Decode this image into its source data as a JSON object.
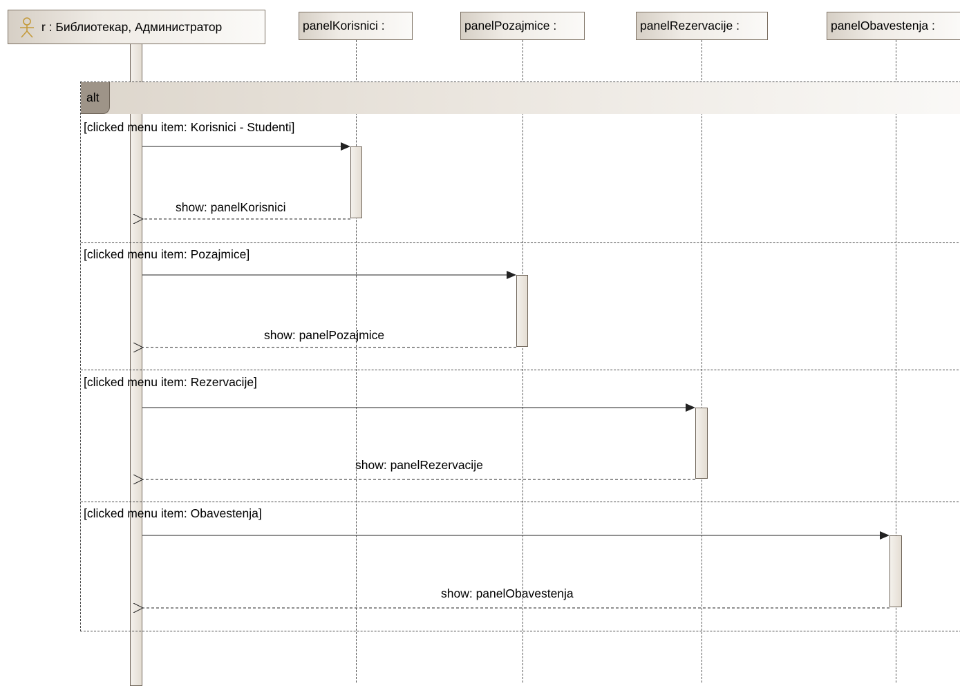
{
  "actor": {
    "label": "r : Библиотекар, Администратор",
    "icon": "actor-stick-figure-icon"
  },
  "lifelines": [
    {
      "label": "panelKorisnici :"
    },
    {
      "label": "panelPozajmice :"
    },
    {
      "label": "panelRezervacije :"
    },
    {
      "label": "panelObavestenja :"
    }
  ],
  "fragment": {
    "operator": "alt",
    "operands": [
      {
        "guard": "[clicked menu item: Korisnici - Studenti]",
        "reply": "show: panelKorisnici"
      },
      {
        "guard": "[clicked menu item: Pozajmice]",
        "reply": "show: panelPozajmice"
      },
      {
        "guard": "[clicked menu item: Rezervacije]",
        "reply": "show: panelRezervacije"
      },
      {
        "guard": "[clicked menu item: Obavestenja]",
        "reply": "show: panelObavestenja"
      }
    ]
  },
  "colors": {
    "lifeline_head": "#efebe5",
    "frame_tag": "#9e9488",
    "line": "#555555"
  }
}
